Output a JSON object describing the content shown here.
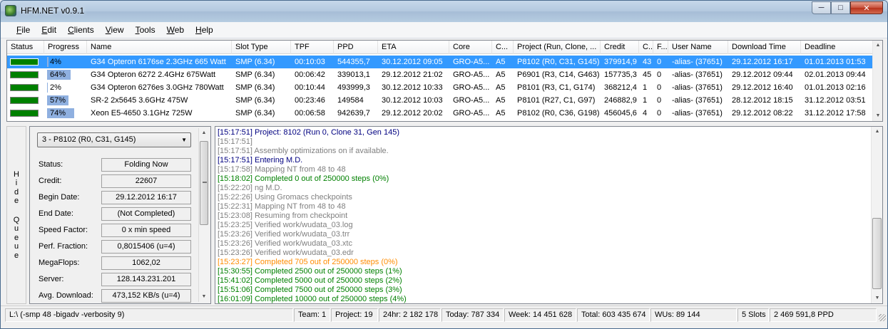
{
  "window": {
    "title": "HFM.NET v0.9.1"
  },
  "menu": [
    "File",
    "Edit",
    "Clients",
    "View",
    "Tools",
    "Web",
    "Help"
  ],
  "grid": {
    "columns": [
      "Status",
      "Progress",
      "Name",
      "Slot Type",
      "TPF",
      "PPD",
      "ETA",
      "Core",
      "C...",
      "Project (Run, Clone, ...",
      "Credit",
      "C...",
      "F...",
      "User Name",
      "Download Time",
      "Deadline"
    ],
    "sorted_column": "Name",
    "selected_row": 0,
    "rows": [
      {
        "status_color": "#008000",
        "progress": "4%",
        "progress_value": 0.04,
        "name": "G34 Opteron 6176se 2.3GHz 665 Watt",
        "slot_type": "SMP (6.34)",
        "tpf": "00:10:03",
        "ppd": "544355,7",
        "eta": "30.12.2012 09:05",
        "core": "GRO-A5...",
        "c": "A5",
        "project": "P8102 (R0, C31, G145)",
        "credit": "379914,9",
        "c2": "43",
        "f": "0",
        "user": "-alias- (37651)",
        "download": "29.12.2012 16:17",
        "deadline": "01.01.2013 01:53"
      },
      {
        "status_color": "#008000",
        "progress": "64%",
        "progress_value": 0.64,
        "name": "G34 Opteron 6272 2.4GHz 675Watt",
        "slot_type": "SMP (6.34)",
        "tpf": "00:06:42",
        "ppd": "339013,1",
        "eta": "29.12.2012 21:02",
        "core": "GRO-A5...",
        "c": "A5",
        "project": "P6901 (R3, C14, G463)",
        "credit": "157735,3",
        "c2": "45",
        "f": "0",
        "user": "-alias- (37651)",
        "download": "29.12.2012 09:44",
        "deadline": "02.01.2013 09:44"
      },
      {
        "status_color": "#008000",
        "progress": "2%",
        "progress_value": 0.02,
        "name": "G34 Opteron 6276es 3.0GHz 780Watt",
        "slot_type": "SMP (6.34)",
        "tpf": "00:10:44",
        "ppd": "493999,3",
        "eta": "30.12.2012 10:33",
        "core": "GRO-A5...",
        "c": "A5",
        "project": "P8101 (R3, C1, G174)",
        "credit": "368212,4",
        "c2": "1",
        "f": "0",
        "user": "-alias- (37651)",
        "download": "29.12.2012 16:40",
        "deadline": "01.01.2013 02:16"
      },
      {
        "status_color": "#008000",
        "progress": "57%",
        "progress_value": 0.57,
        "name": "SR-2 2x5645 3.6GHz 475W",
        "slot_type": "SMP (6.34)",
        "tpf": "00:23:46",
        "ppd": "149584",
        "eta": "30.12.2012 10:03",
        "core": "GRO-A5...",
        "c": "A5",
        "project": "P8101 (R27, C1, G97)",
        "credit": "246882,9",
        "c2": "1",
        "f": "0",
        "user": "-alias- (37651)",
        "download": "28.12.2012 18:15",
        "deadline": "31.12.2012 03:51"
      },
      {
        "status_color": "#008000",
        "progress": "74%",
        "progress_value": 0.74,
        "name": "Xeon E5-4650 3.1GHz 725W",
        "slot_type": "SMP (6.34)",
        "tpf": "00:06:58",
        "ppd": "942639,7",
        "eta": "29.12.2012 20:02",
        "core": "GRO-A5...",
        "c": "A5",
        "project": "P8102 (R0, C36, G198)",
        "credit": "456045,6",
        "c2": "4",
        "f": "0",
        "user": "-alias- (37651)",
        "download": "29.12.2012 08:22",
        "deadline": "31.12.2012 17:58"
      }
    ]
  },
  "hide_queue": {
    "word1": [
      "H",
      "i",
      "d",
      "e"
    ],
    "word2": [
      "Q",
      "u",
      "e",
      "u",
      "e"
    ]
  },
  "queue": {
    "selected": "3 - P8102 (R0, C31, G145)",
    "fields": [
      {
        "label": "Status:",
        "value": "Folding Now"
      },
      {
        "label": "Credit:",
        "value": "22607"
      },
      {
        "label": "Begin Date:",
        "value": "29.12.2012 16:17"
      },
      {
        "label": "End Date:",
        "value": "(Not Completed)"
      },
      {
        "label": "Speed Factor:",
        "value": "0 x min speed"
      },
      {
        "label": "Perf. Fraction:",
        "value": "0,8015406 (u=4)"
      },
      {
        "label": "MegaFlops:",
        "value": "1062,02"
      },
      {
        "label": "Server:",
        "value": "128.143.231.201"
      },
      {
        "label": "Avg. Download:",
        "value": "473,152 KB/s (u=4)"
      }
    ]
  },
  "log": {
    "colors": {
      "info": "#000080",
      "gray": "#808080",
      "green": "#008000",
      "orange": "#ff8c00"
    },
    "lines": [
      {
        "text": "[15:17:51] Project: 8102 (Run 0, Clone 31, Gen 145)",
        "kind": "info"
      },
      {
        "text": "[15:17:51]",
        "kind": "gray"
      },
      {
        "text": "[15:17:51] Assembly optimizations on if available.",
        "kind": "gray"
      },
      {
        "text": "[15:17:51] Entering M.D.",
        "kind": "info"
      },
      {
        "text": "[15:17:58] Mapping NT from 48 to 48",
        "kind": "gray"
      },
      {
        "text": "[15:18:02] Completed 0 out of 250000 steps  (0%)",
        "kind": "green"
      },
      {
        "text": "[15:22:20] ng M.D.",
        "kind": "gray"
      },
      {
        "text": "[15:22:26] Using Gromacs checkpoints",
        "kind": "gray"
      },
      {
        "text": "[15:22:31] Mapping NT from 48 to 48",
        "kind": "gray"
      },
      {
        "text": "[15:23:08] Resuming from checkpoint",
        "kind": "gray"
      },
      {
        "text": "[15:23:25] Verified work/wudata_03.log",
        "kind": "gray"
      },
      {
        "text": "[15:23:26] Verified work/wudata_03.trr",
        "kind": "gray"
      },
      {
        "text": "[15:23:26] Verified work/wudata_03.xtc",
        "kind": "gray"
      },
      {
        "text": "[15:23:26] Verified work/wudata_03.edr",
        "kind": "gray"
      },
      {
        "text": "[15:23:27] Completed 705 out of 250000 steps  (0%)",
        "kind": "orange"
      },
      {
        "text": "[15:30:55] Completed 2500 out of 250000 steps  (1%)",
        "kind": "green"
      },
      {
        "text": "[15:41:02] Completed 5000 out of 250000 steps  (2%)",
        "kind": "green"
      },
      {
        "text": "[15:51:06] Completed 7500 out of 250000 steps  (3%)",
        "kind": "green"
      },
      {
        "text": "[16:01:09] Completed 10000 out of 250000 steps  (4%)",
        "kind": "green"
      }
    ]
  },
  "statusbar": {
    "arguments": "L:\\ (-smp 48 -bigadv -verbosity 9)",
    "team": "Team: 1",
    "project": "Project: 19",
    "h24": "24hr: 2 182 178",
    "today": "Today: 787 334",
    "week": "Week: 14 451 628",
    "total": "Total: 603 435 674",
    "wus": "WUs: 89 144",
    "slots": "5 Slots",
    "ppd": "2 469 591,8 PPD"
  }
}
